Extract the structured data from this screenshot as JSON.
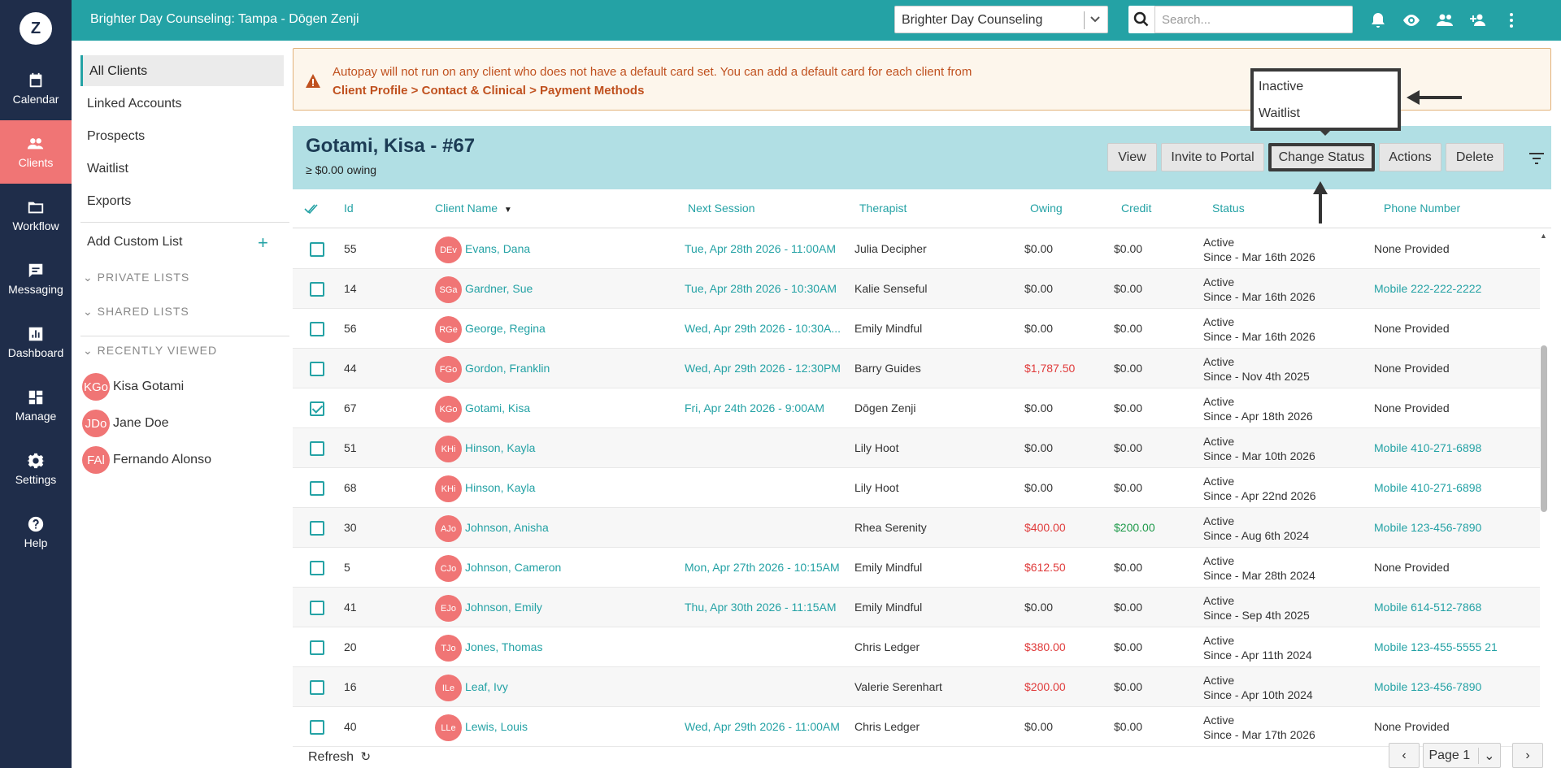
{
  "app": {
    "logo_letter": "Z",
    "top_title": "Brighter Day Counseling: Tampa - Dōgen Zenji",
    "practice_select": "Brighter Day Counseling",
    "search_placeholder": "Search..."
  },
  "nav": [
    {
      "label": "Calendar",
      "icon": "calendar-icon"
    },
    {
      "label": "Clients",
      "icon": "clients-icon",
      "active": true
    },
    {
      "label": "Workflow",
      "icon": "folder-icon"
    },
    {
      "label": "Messaging",
      "icon": "message-icon"
    },
    {
      "label": "Dashboard",
      "icon": "chart-icon"
    },
    {
      "label": "Manage",
      "icon": "grid-icon"
    },
    {
      "label": "Settings",
      "icon": "gear-icon"
    },
    {
      "label": "Help",
      "icon": "help-icon"
    }
  ],
  "sidebar": {
    "lists": [
      "All Clients",
      "Linked Accounts",
      "Prospects",
      "Waitlist",
      "Exports"
    ],
    "add_custom": "Add Custom List",
    "private_lists": "PRIVATE LISTS",
    "shared_lists": "SHARED LISTS",
    "recently_viewed": "RECENTLY VIEWED",
    "recent": [
      {
        "initials": "KGo",
        "name": "Kisa Gotami"
      },
      {
        "initials": "JDo",
        "name": "Jane Doe"
      },
      {
        "initials": "FAl",
        "name": "Fernando Alonso"
      }
    ]
  },
  "alert": {
    "text": "Autopay will not run on any client who does not have a default card set. You can add a default card for each client from",
    "path": "Client Profile > Contact & Clinical > Payment Methods"
  },
  "client": {
    "name": "Gotami, Kisa - #67",
    "owing": "≥ $0.00 owing",
    "buttons": {
      "view": "View",
      "invite": "Invite to Portal",
      "change_status": "Change Status",
      "actions": "Actions",
      "delete": "Delete"
    }
  },
  "dropdown": {
    "options": [
      "Inactive",
      "Waitlist"
    ]
  },
  "table": {
    "headers": {
      "id": "Id",
      "client_name": "Client Name",
      "next_session": "Next Session",
      "therapist": "Therapist",
      "owing": "Owing",
      "credit": "Credit",
      "status": "Status",
      "phone": "Phone Number"
    },
    "rows": [
      {
        "id": "55",
        "initials": "DEv",
        "name": "Evans, Dana",
        "next": "Tue, Apr 28th 2026 - 11:00AM",
        "therapist": "Julia Decipher",
        "owing": "$0.00",
        "credit": "$0.00",
        "status": "Active",
        "since": "Since - Mar 16th 2026",
        "phone": "None Provided"
      },
      {
        "id": "14",
        "initials": "SGa",
        "name": "Gardner, Sue",
        "next": "Tue, Apr 28th 2026 - 10:30AM",
        "therapist": "Kalie Senseful",
        "owing": "$0.00",
        "credit": "$0.00",
        "status": "Active",
        "since": "Since - Mar 16th 2026",
        "phone": "Mobile 222-222-2222"
      },
      {
        "id": "56",
        "initials": "RGe",
        "name": "George, Regina",
        "next": "Wed, Apr 29th 2026 - 10:30A...",
        "therapist": "Emily Mindful",
        "owing": "$0.00",
        "credit": "$0.00",
        "status": "Active",
        "since": "Since - Mar 16th 2026",
        "phone": "None Provided"
      },
      {
        "id": "44",
        "initials": "FGo",
        "name": "Gordon, Franklin",
        "next": "Wed, Apr 29th 2026 - 12:30PM",
        "therapist": "Barry Guides",
        "owing": "$1,787.50",
        "credit": "$0.00",
        "status": "Active",
        "since": "Since - Nov 4th 2025",
        "phone": "None Provided"
      },
      {
        "id": "67",
        "initials": "KGo",
        "name": "Gotami, Kisa",
        "next": "Fri, Apr 24th 2026 - 9:00AM",
        "therapist": "Dōgen Zenji",
        "owing": "$0.00",
        "credit": "$0.00",
        "status": "Active",
        "since": "Since - Apr 18th 2026",
        "phone": "None Provided",
        "checked": true
      },
      {
        "id": "51",
        "initials": "KHi",
        "name": "Hinson, Kayla",
        "next": "",
        "therapist": "Lily Hoot",
        "owing": "$0.00",
        "credit": "$0.00",
        "status": "Active",
        "since": "Since - Mar 10th 2026",
        "phone": "Mobile 410-271-6898"
      },
      {
        "id": "68",
        "initials": "KHi",
        "name": "Hinson, Kayla",
        "next": "",
        "therapist": "Lily Hoot",
        "owing": "$0.00",
        "credit": "$0.00",
        "status": "Active",
        "since": "Since - Apr 22nd 2026",
        "phone": "Mobile 410-271-6898"
      },
      {
        "id": "30",
        "initials": "AJo",
        "name": "Johnson, Anisha",
        "next": "",
        "therapist": "Rhea Serenity",
        "owing": "$400.00",
        "credit": "$200.00",
        "status": "Active",
        "since": "Since - Aug 6th 2024",
        "phone": "Mobile 123-456-7890"
      },
      {
        "id": "5",
        "initials": "CJo",
        "name": "Johnson, Cameron",
        "next": "Mon, Apr 27th 2026 - 10:15AM",
        "therapist": "Emily Mindful",
        "owing": "$612.50",
        "credit": "$0.00",
        "status": "Active",
        "since": "Since - Mar 28th 2024",
        "phone": "None Provided"
      },
      {
        "id": "41",
        "initials": "EJo",
        "name": "Johnson, Emily",
        "next": "Thu, Apr 30th 2026 - 11:15AM",
        "therapist": "Emily Mindful",
        "owing": "$0.00",
        "credit": "$0.00",
        "status": "Active",
        "since": "Since - Sep 4th 2025",
        "phone": "Mobile 614-512-7868"
      },
      {
        "id": "20",
        "initials": "TJo",
        "name": "Jones, Thomas",
        "next": "",
        "therapist": "Chris Ledger",
        "owing": "$380.00",
        "credit": "$0.00",
        "status": "Active",
        "since": "Since - Apr 11th 2024",
        "phone": "Mobile 123-455-5555 21"
      },
      {
        "id": "16",
        "initials": "ILe",
        "name": "Leaf, Ivy",
        "next": "",
        "therapist": "Valerie Serenhart",
        "owing": "$200.00",
        "credit": "$0.00",
        "status": "Active",
        "since": "Since - Apr 10th 2024",
        "phone": "Mobile 123-456-7890"
      },
      {
        "id": "40",
        "initials": "LLe",
        "name": "Lewis, Louis",
        "next": "Wed, Apr 29th 2026 - 11:00AM",
        "therapist": "Chris Ledger",
        "owing": "$0.00",
        "credit": "$0.00",
        "status": "Active",
        "since": "Since - Mar 17th 2026",
        "phone": "None Provided"
      }
    ]
  },
  "footer": {
    "refresh": "Refresh",
    "page": "Page 1"
  },
  "colors": {
    "teal": "#24a2a5",
    "navy": "#1f2d4a",
    "coral": "#f07575",
    "alert_text": "#c0511f"
  }
}
